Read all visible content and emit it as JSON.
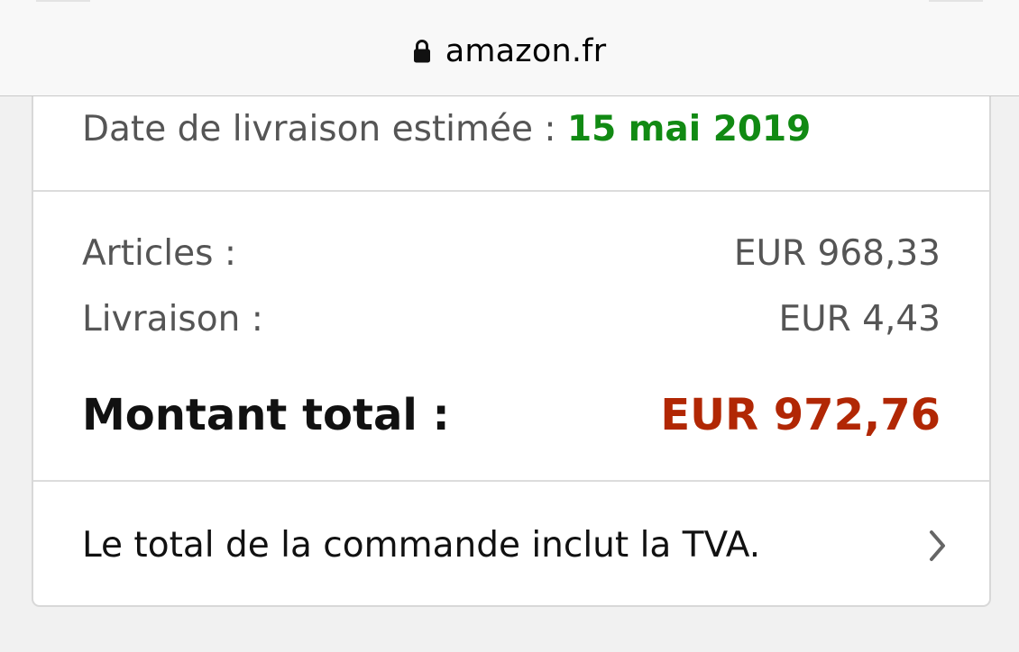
{
  "browser": {
    "url": "amazon.fr",
    "lock_icon": "lock-icon"
  },
  "order_summary": {
    "delivery": {
      "label": "Date de livraison estimée : ",
      "date": "15 mai 2019"
    },
    "items": {
      "label": "Articles :",
      "value": "EUR 968,33"
    },
    "shipping": {
      "label": "Livraison :",
      "value": "EUR 4,43"
    },
    "total": {
      "label": "Montant total :",
      "value": "EUR 972,76"
    },
    "vat_note": {
      "text": "Le total de la commande inclut la TVA.",
      "icon": "chevron-right-icon"
    }
  },
  "colors": {
    "delivery_date": "#118a13",
    "total_value": "#b12704",
    "muted_text": "#555555",
    "page_background": "#f1f1f1"
  }
}
